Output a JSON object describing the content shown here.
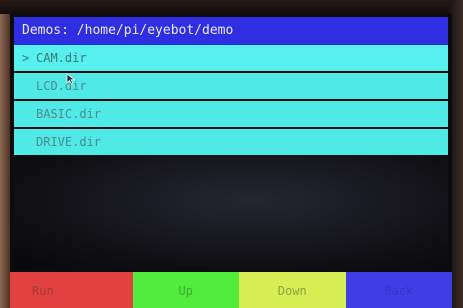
{
  "header": {
    "title": "Demos: /home/pi/eyebot/demo"
  },
  "file_list": {
    "selected_marker": ">",
    "items": [
      {
        "label": "CAM.dir",
        "selected": true
      },
      {
        "label": "LCD.dir",
        "selected": false
      },
      {
        "label": "BASIC.dir",
        "selected": false
      },
      {
        "label": "DRIVE.dir",
        "selected": false
      }
    ]
  },
  "softkeys": {
    "run": "Run",
    "up": "Up",
    "down": "Down",
    "back": "Back"
  },
  "colors": {
    "title_bar": "#2f2ee0",
    "list_item": "#4fe9e6",
    "run": "#e2413f",
    "up": "#52ec3c",
    "down": "#d7ef55",
    "back": "#3f3ee6"
  }
}
